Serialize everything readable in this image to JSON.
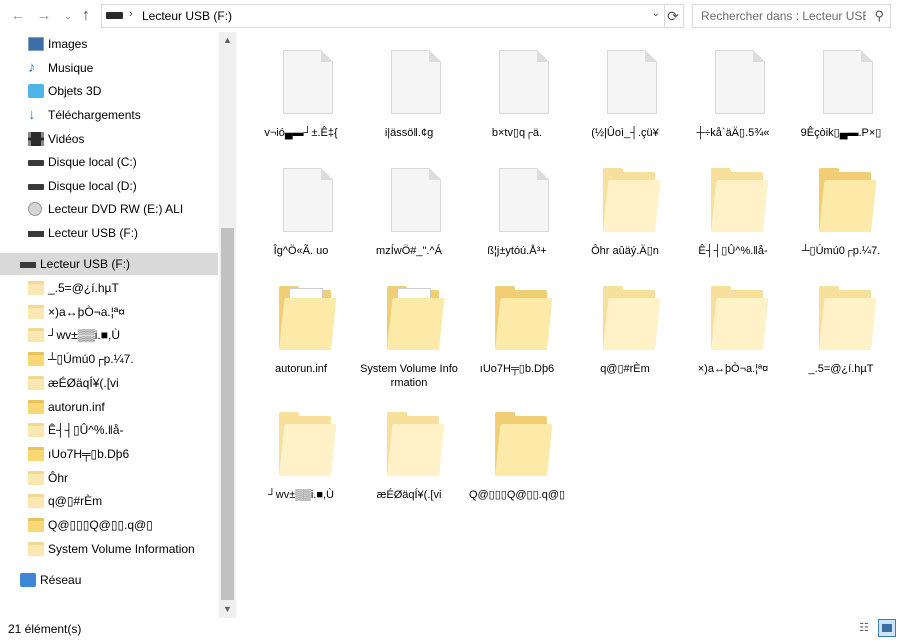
{
  "address": {
    "path_label": "Lecteur USB (F:)",
    "search_placeholder": "Rechercher dans : Lecteur USB (F:)"
  },
  "nav_glyphs": {
    "back": "←",
    "forward": "→",
    "recent": "⌄",
    "up": "↑",
    "refresh": "⟳",
    "dropdown": "⌄",
    "path_sep": "›",
    "search": "⚲"
  },
  "sidebar": {
    "items": [
      {
        "label": "Images",
        "icon": "images-icon"
      },
      {
        "label": "Musique",
        "icon": "music-icon"
      },
      {
        "label": "Objets 3D",
        "icon": "objects-3d-icon"
      },
      {
        "label": "Téléchargements",
        "icon": "downloads-icon"
      },
      {
        "label": "Vidéos",
        "icon": "videos-icon"
      },
      {
        "label": "Disque local (C:)",
        "icon": "drive-icon"
      },
      {
        "label": "Disque local (D:)",
        "icon": "drive-icon"
      },
      {
        "label": "Lecteur DVD RW (E:) ALI",
        "icon": "dvd-icon"
      },
      {
        "label": "Lecteur USB (F:)",
        "icon": "usb-drive-icon"
      }
    ],
    "usb_root": {
      "label": "Lecteur USB (F:)",
      "icon": "usb-drive-icon"
    },
    "usb_children": [
      {
        "label": "_.5=@¿í.hµT",
        "icon": "folder-icon"
      },
      {
        "label": "×)a↔þÒ¬a.¦ª¤",
        "icon": "folder-icon"
      },
      {
        "label": "┘wv±▒▒i.■,Ù",
        "icon": "folder-icon"
      },
      {
        "label": "┴▯Úmú0┌p.¼7.",
        "icon": "folder-icon"
      },
      {
        "label": "æÉØäqÍ¥(.[vi",
        "icon": "folder-icon"
      },
      {
        "label": "autorun.inf",
        "icon": "folder-icon"
      },
      {
        "label": "Ê┤┤▯Û^%.‖å-",
        "icon": "folder-icon"
      },
      {
        "label": "ıUo7H╤▯b.Dþ6",
        "icon": "folder-icon"
      },
      {
        "label": "Ôhr",
        "icon": "folder-icon"
      },
      {
        "label": "q@▯#rÈm",
        "icon": "folder-icon"
      },
      {
        "label": "Q@▯▯▯Q@▯▯.q@▯",
        "icon": "folder-icon"
      },
      {
        "label": "System Volume Information",
        "icon": "folder-icon"
      }
    ],
    "network": {
      "label": "Réseau",
      "icon": "network-icon"
    },
    "scroll_up": "▲",
    "scroll_down": "▼"
  },
  "content": {
    "items": [
      {
        "name": "v¬ió▄▬┘±.Ê‡{",
        "type": "file"
      },
      {
        "name": "i|ässö‖.¢g",
        "type": "file"
      },
      {
        "name": "b×tv▯q┌ä.",
        "type": "file"
      },
      {
        "name": "(½|Ûoì_┤.çü¥",
        "type": "file"
      },
      {
        "name": "┼÷kå`äÄ▯.5¾«",
        "type": "file"
      },
      {
        "name": "9Êçòik▯▄▬.P×▯",
        "type": "file"
      },
      {
        "name": "Îg^Ö«Ã. uo",
        "type": "file"
      },
      {
        "name": "mzÍwÖ#_\".^Á",
        "type": "file"
      },
      {
        "name": "ß¦j±ytóú.Å³+",
        "type": "file"
      },
      {
        "name": "Ôhr aûäý.Ä▯n",
        "type": "folder-pale"
      },
      {
        "name": "Ê┤┤▯Û^%.‖å-",
        "type": "folder-pale"
      },
      {
        "name": "┴▯Úmú0┌p.¼7.",
        "type": "folder"
      },
      {
        "name": "autorun.inf",
        "type": "folder-doc"
      },
      {
        "name": "System Volume Information",
        "type": "folder-doc"
      },
      {
        "name": "ıUo7H╤▯b.Dþ6",
        "type": "folder"
      },
      {
        "name": "q@▯#rÈm",
        "type": "folder-pale"
      },
      {
        "name": "×)a↔þÒ¬a.¦ª¤",
        "type": "folder-pale"
      },
      {
        "name": "_.5=@¿í.hµT",
        "type": "folder-pale"
      },
      {
        "name": "┘wv±▒▒i.■,Ù",
        "type": "folder-pale"
      },
      {
        "name": "æÉØäqÍ¥(.[vi",
        "type": "folder-pale"
      },
      {
        "name": "Q@▯▯▯Q@▯▯.q@▯",
        "type": "folder"
      }
    ]
  },
  "status": {
    "count": "21 élément(s)",
    "view_details_glyph": "☷"
  }
}
